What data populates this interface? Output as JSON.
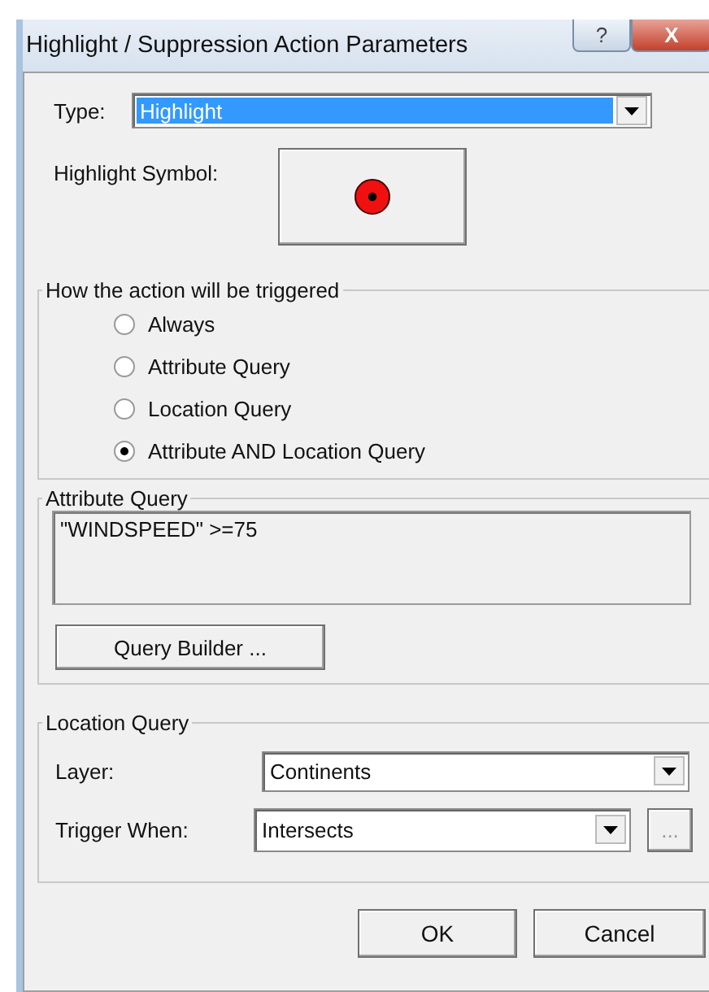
{
  "window": {
    "title": "Highlight / Suppression Action Parameters",
    "title_buttons": [
      "?",
      "X"
    ]
  },
  "type": {
    "label": "Type:",
    "value": "Highlight"
  },
  "highlight_symbol": {
    "label": "Highlight Symbol:"
  },
  "trigger": {
    "title": "How the action will be triggered",
    "options": [
      {
        "label": "Always",
        "selected": false
      },
      {
        "label": "Attribute Query",
        "selected": false
      },
      {
        "label": "Location Query",
        "selected": false
      },
      {
        "label": "Attribute AND Location Query",
        "selected": true
      }
    ]
  },
  "attribute_query": {
    "title": "Attribute Query",
    "query": "\"WINDSPEED\" >=75",
    "button": "Query Builder ..."
  },
  "location_query": {
    "title": "Location Query",
    "layer_label": "Layer:",
    "layer": "Continents",
    "trigger_label": "Trigger When:",
    "trigger_value": "Intersects",
    "more_button": "..."
  },
  "buttons": [
    "OK",
    "Cancel"
  ]
}
